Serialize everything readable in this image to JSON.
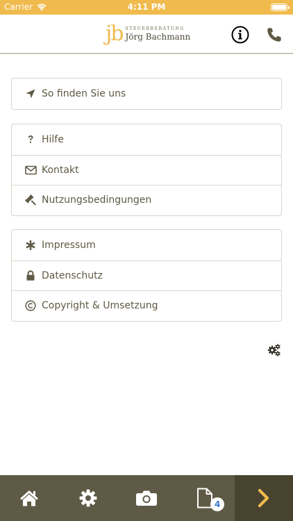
{
  "status_bar": {
    "carrier": "Carrier",
    "time": "4:11 PM"
  },
  "header": {
    "logo_mark": "jb",
    "logo_subtitle": "STEUERBERATUNG",
    "logo_name": "Jörg Bachmann",
    "info_icon": "info-circle-icon",
    "phone_icon": "phone-icon"
  },
  "groups": [
    {
      "items": [
        {
          "label": "So finden Sie uns",
          "icon": "location-arrow-icon"
        }
      ]
    },
    {
      "items": [
        {
          "label": "Hilfe",
          "icon": "question-icon"
        },
        {
          "label": "Kontakt",
          "icon": "envelope-icon"
        },
        {
          "label": "Nutzungsbedingungen",
          "icon": "gavel-icon"
        }
      ]
    },
    {
      "items": [
        {
          "label": "Impressum",
          "icon": "asterisk-icon"
        },
        {
          "label": "Datenschutz",
          "icon": "lock-icon"
        },
        {
          "label": "Copyright & Umsetzung",
          "icon": "copyright-icon"
        }
      ]
    }
  ],
  "tab_bar": {
    "tabs": [
      {
        "name": "home",
        "icon": "home-icon"
      },
      {
        "name": "settings",
        "icon": "gear-icon"
      },
      {
        "name": "camera",
        "icon": "camera-icon"
      },
      {
        "name": "documents",
        "icon": "document-icon",
        "badge": "4"
      },
      {
        "name": "next",
        "icon": "chevron-right-icon"
      }
    ]
  },
  "colors": {
    "accent": "#f0ba4d",
    "text": "#5e5a45",
    "tabbar": "#5e5a45",
    "tabbar_active": "#47432f",
    "badge_text": "#3b7ac9"
  }
}
